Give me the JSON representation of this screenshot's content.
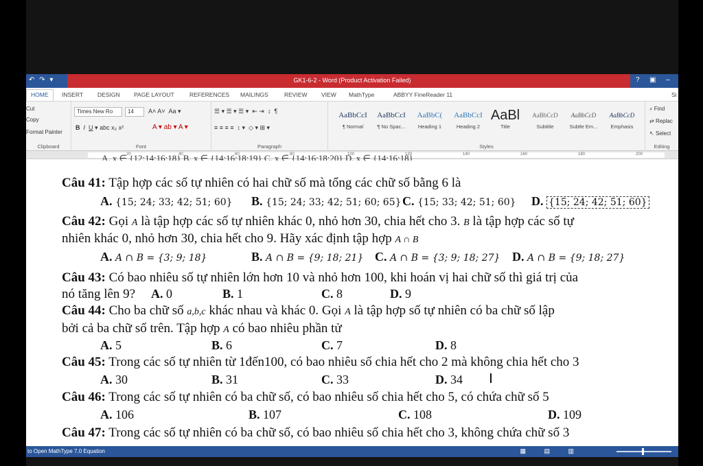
{
  "window": {
    "title": "GK1-6-2 - Word (Product Activation Failed)",
    "help": "?",
    "restore": "▣",
    "minimize": "–"
  },
  "tabs": [
    "HOME",
    "INSERT",
    "DESIGN",
    "PAGE LAYOUT",
    "REFERENCES",
    "MAILINGS",
    "REVIEW",
    "VIEW",
    "MathType",
    "ABBYY FineReader 11"
  ],
  "tabs_right": "Si",
  "ribbon": {
    "clipboard": {
      "cut": "Cut",
      "copy": "Copy",
      "format_painter": "Format Painter",
      "label": "Clipboard"
    },
    "font": {
      "name": "Times New Ro",
      "size": "14",
      "label": "Font"
    },
    "paragraph": {
      "label": "Paragraph"
    },
    "styles": {
      "label": "Styles",
      "items": [
        {
          "sample": "AaBbCcI",
          "name": "¶ Normal"
        },
        {
          "sample": "AaBbCcI",
          "name": "¶ No Spac..."
        },
        {
          "sample": "AaBbC(",
          "name": "Heading 1"
        },
        {
          "sample": "AaBbCcI",
          "name": "Heading 2"
        },
        {
          "sample": "AaBl",
          "name": "Title"
        },
        {
          "sample": "AaBbCcD",
          "name": "Subtitle"
        },
        {
          "sample": "AaBbCcD",
          "name": "Subtle Em..."
        },
        {
          "sample": "AaBbCcD",
          "name": "Emphasis"
        }
      ]
    },
    "editing": {
      "find": "Find",
      "replace": "Replac",
      "select": "Select",
      "label": "Editing"
    }
  },
  "ruler": {
    "marks": [
      "20",
      "40",
      "60",
      "80",
      "100",
      "120",
      "140",
      "160",
      "180",
      "200"
    ]
  },
  "document": {
    "top_partial": "A. x ∈ {12;14;16;18}      B. x ∈ {14;16;18;19}      C. x ∈ {14;16;18;20}      D. x ∈ {14;16;18}",
    "q41": {
      "label": "Câu 41:",
      "text": " Tập hợp các số tự nhiên có hai chữ số mà tổng các chữ số bằng 6 là"
    },
    "q41_opts": [
      {
        "letter": "A.",
        "value": "{15; 24; 33; 42; 51; 60}"
      },
      {
        "letter": "B.",
        "value": "{15; 24; 33; 42; 51; 60; 65}"
      },
      {
        "letter": "C.",
        "value": "{15; 33; 42; 51; 60}"
      },
      {
        "letter": "D.",
        "value": "{15; 24; 42; 51; 60}"
      }
    ],
    "q42": {
      "label": "Câu 42:",
      "text1": " Gọi ",
      "a": "A",
      "text2": " là tập hợp các số tự nhiên khác 0, nhỏ hơn 30, chia hết cho 3. ",
      "b": "B",
      "text3": " là tập hợp các số tự",
      "line2": "nhiên khác 0, nhỏ hơn 30, chia hết cho 9. Hãy xác định tập hợp ",
      "expr": "A ∩ B"
    },
    "q42_opts": [
      {
        "letter": "A.",
        "value": "A ∩ B = {3; 9; 18}"
      },
      {
        "letter": "B.",
        "value": "A ∩ B = {9; 18; 21}"
      },
      {
        "letter": "C.",
        "value": "A ∩ B = {3; 9; 18; 27}"
      },
      {
        "letter": "D.",
        "value": "A ∩ B = {9; 18; 27}"
      }
    ],
    "q43": {
      "label": "Câu 43:",
      "text": " Có bao nhiêu số tự nhiên lớn hơn 10 và nhỏ hơn 100, khi hoán vị hai chữ số thì giá trị của",
      "line2": "nó tăng lên 9?"
    },
    "q43_opts": [
      {
        "letter": "A.",
        "value": " 0"
      },
      {
        "letter": "B.",
        "value": " 1"
      },
      {
        "letter": "C.",
        "value": " 8"
      },
      {
        "letter": "D.",
        "value": " 9"
      }
    ],
    "q44": {
      "label": "Câu 44:",
      "text1": " Cho ba chữ số ",
      "digits": "a,b,c",
      "text2": " khác nhau và khác 0. Gọi ",
      "a": "A",
      "text3": " là tập hợp số tự nhiên có ba chữ số lập",
      "line2a": "bởi cả ba chữ số trên. Tập hợp ",
      "line2b": " có bao nhiêu phần tử"
    },
    "q44_opts": [
      {
        "letter": "A.",
        "value": " 5"
      },
      {
        "letter": "B.",
        "value": " 6"
      },
      {
        "letter": "C.",
        "value": " 7"
      },
      {
        "letter": "D.",
        "value": " 8"
      }
    ],
    "q45": {
      "label": "Câu 45:",
      "text": " Trong các số tự nhiên từ 1đến100, có bao nhiêu số chia hết cho 2 mà không chia hết cho 3"
    },
    "q45_opts": [
      {
        "letter": "A.",
        "value": " 30"
      },
      {
        "letter": "B.",
        "value": " 31"
      },
      {
        "letter": "C.",
        "value": " 33"
      },
      {
        "letter": "D.",
        "value": " 34"
      }
    ],
    "q46": {
      "label": "Câu 46:",
      "text": " Trong các số tự nhiên có ba chữ số, có bao nhiêu số chia hết cho 5, có chứa chữ số 5"
    },
    "q46_opts": [
      {
        "letter": "A.",
        "value": " 106"
      },
      {
        "letter": "B.",
        "value": " 107"
      },
      {
        "letter": "C.",
        "value": " 108"
      },
      {
        "letter": "D.",
        "value": " 109"
      }
    ],
    "q47": {
      "label": "Câu 47:",
      "text": " Trong các số tự nhiên có ba chữ số, có bao nhiêu số chia hết cho 3, không chứa chữ số 3"
    }
  },
  "statusbar": {
    "text": "to Open MathType 7.0 Equation"
  }
}
